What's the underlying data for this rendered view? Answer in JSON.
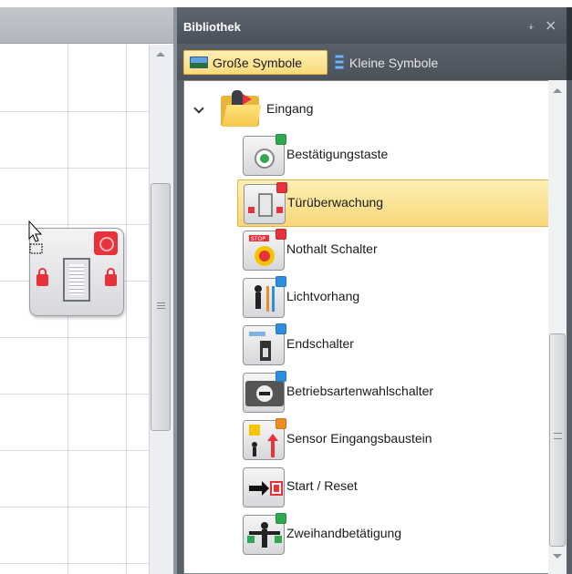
{
  "panel": {
    "title": "Bibliothek",
    "pin_glyph": "⨨",
    "close_glyph": "×"
  },
  "toolbar": {
    "large_symbols": "Große Symbole",
    "small_symbols": "Kleine Symbole"
  },
  "folder": {
    "label": "Eingang",
    "icon": "folder-icon"
  },
  "items": [
    {
      "label": "Bestätigungstaste",
      "icon": "confirm-button-icon",
      "badge_color": "#2fa84f"
    },
    {
      "label": "Türüberwachung",
      "icon": "door-monitoring-icon",
      "badge_color": "#e8323b",
      "selected": true
    },
    {
      "label": "Nothalt Schalter",
      "icon": "emergency-stop-icon",
      "badge_color": "#e8323b"
    },
    {
      "label": "Lichtvorhang",
      "icon": "light-curtain-icon",
      "badge_color": "#2e8ddc"
    },
    {
      "label": "Endschalter",
      "icon": "limit-switch-icon",
      "badge_color": "#2e8ddc"
    },
    {
      "label": "Betriebsartenwahlschalter",
      "icon": "mode-selector-icon",
      "badge_color": "#2e8ddc"
    },
    {
      "label": "Sensor Eingangsbaustein",
      "icon": "sensor-input-icon",
      "badge_color": "#f08c21"
    },
    {
      "label": "Start / Reset",
      "icon": "start-reset-icon",
      "badge_color": ""
    },
    {
      "label": "Zweihandbetätigung",
      "icon": "two-hand-control-icon",
      "badge_color": "#2fa84f"
    }
  ],
  "colors": {
    "selection": "#f9da7a",
    "panel_header": "#4a515b",
    "red": "#e8323b",
    "green": "#2fa84f",
    "blue": "#2e8ddc",
    "orange": "#f08c21"
  }
}
